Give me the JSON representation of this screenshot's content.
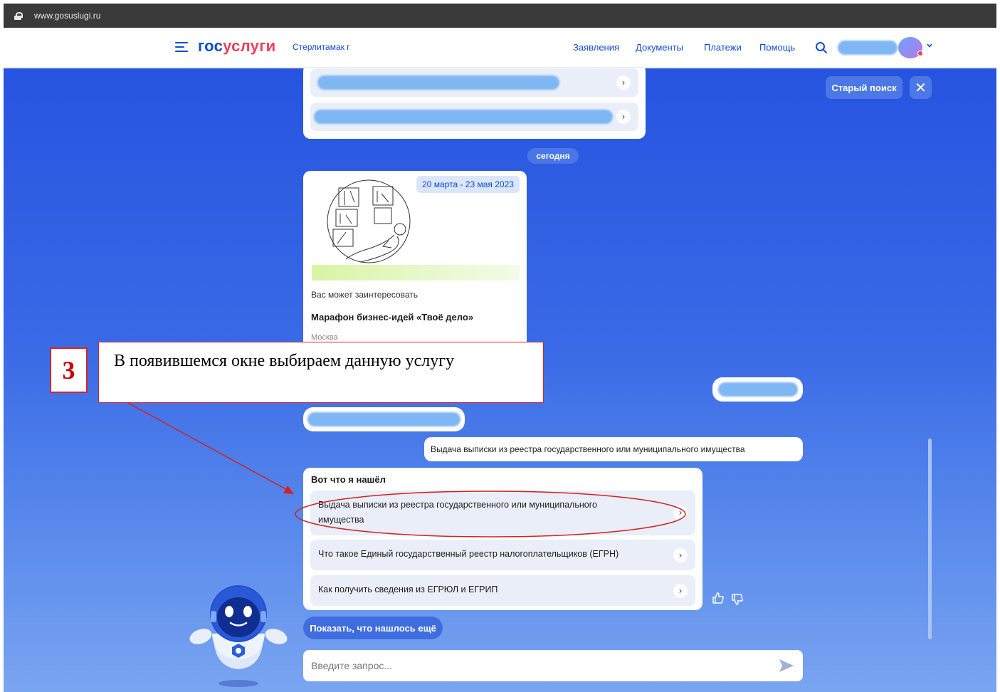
{
  "browser": {
    "url": "www.gosuslugi.ru"
  },
  "header": {
    "logo_part1": "гос",
    "logo_part2": "услуги",
    "city": "Стерлитамак г",
    "nav": [
      "Заявления",
      "Документы",
      "Платежи",
      "Помощь"
    ]
  },
  "panel": {
    "old_search_label": "Старый поиск"
  },
  "chat": {
    "today_label": "сегодня",
    "event_card": {
      "date_range": "20 марта - 23 мая 2023",
      "subtitle": "Вас может заинтересовать",
      "title": "Марафон бизнес-идей «Твоё дело»",
      "city": "Москва"
    },
    "user_query": "Выдача выписки из реестра государственного или муниципального имущества",
    "results": {
      "heading": "Вот что я нашёл",
      "items": [
        {
          "line1": "Выдача выписки из реестра государственного или муниципального",
          "line2": "имущества"
        },
        {
          "line1": "Что такое Единый государственный реестр налогоплательщиков (ЕГРН)",
          "line2": ""
        },
        {
          "line1": "Как получить сведения из ЕГРЮЛ и ЕГРИП",
          "line2": ""
        }
      ]
    },
    "show_more_label": "Показать, что нашлось ещё",
    "input_placeholder": "Введите запрос..."
  },
  "annotation": {
    "number": "3",
    "text": "В появившемся окне выбираем данную услугу"
  },
  "colors": {
    "brand_blue": "#0d4cd3",
    "brand_red": "#ee3f58",
    "annotation_red": "#d22222"
  }
}
